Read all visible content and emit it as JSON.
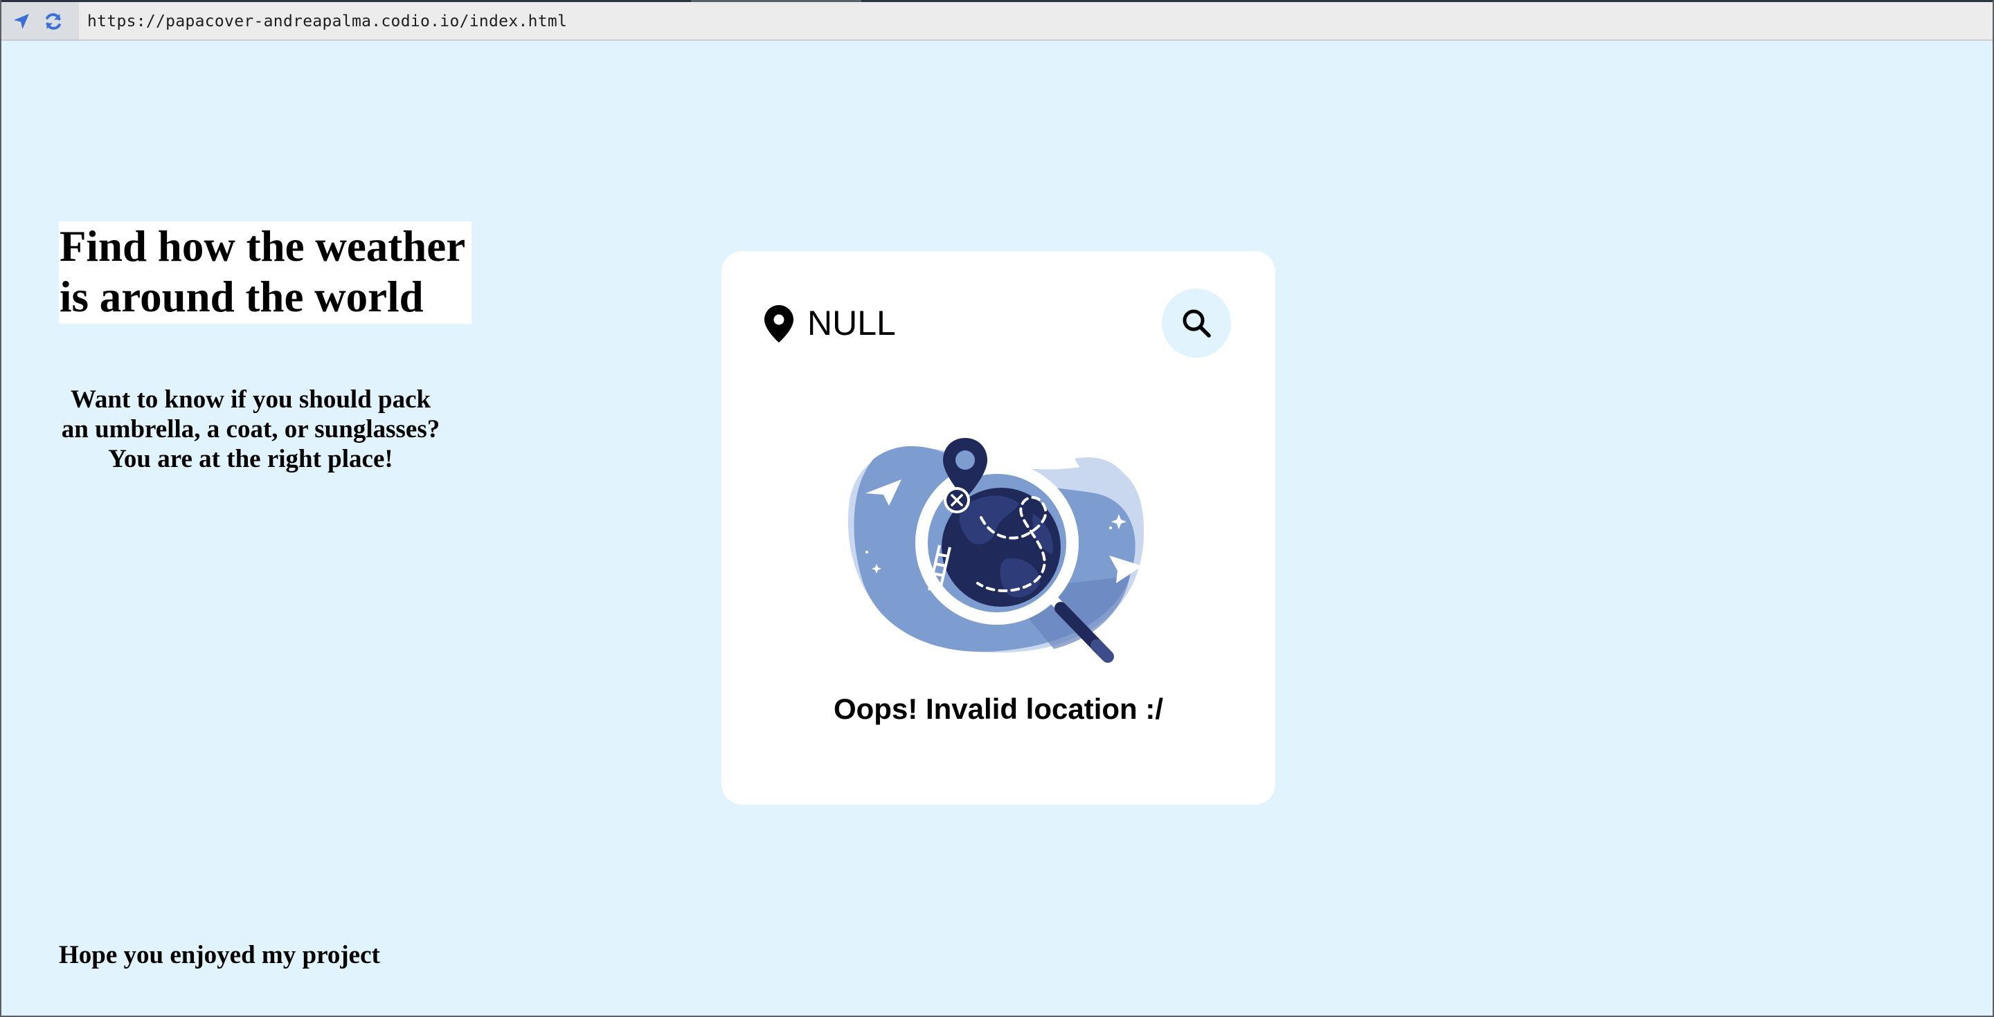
{
  "browser": {
    "url": "https://papacover-andreapalma.codio.io/index.html",
    "nav_icons": [
      "location-arrow-icon",
      "refresh-icon"
    ],
    "accent_color": "#3b6fd6"
  },
  "hero": {
    "title_line1": "Find how the weather",
    "title_line2": "is around the world",
    "subtitle_line1": "Want to know if you should pack",
    "subtitle_line2": "an umbrella, a coat, or sunglasses?",
    "subtitle_line3": "You are at the right place!"
  },
  "weather_card": {
    "location_value": "NULL",
    "location_icon": "map-pin-icon",
    "search_icon": "search-icon",
    "illustration": "globe-magnifier-not-found-illustration",
    "error_message": "Oops! Invalid location :/"
  },
  "footer": {
    "note": "Hope you enjoyed my project"
  },
  "colors": {
    "page_background": "#e1f4fd",
    "card_background": "#ffffff",
    "search_button_background": "#e1f4fd",
    "illustration_blue": "#7b9bd0",
    "illustration_navy": "#1f2a5a"
  }
}
